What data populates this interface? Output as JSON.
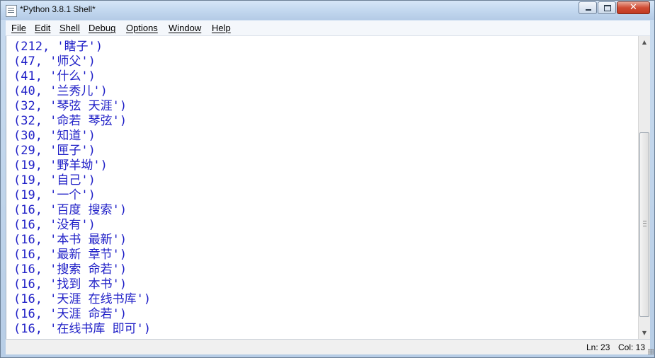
{
  "window": {
    "title": "*Python 3.8.1 Shell*",
    "close_glyph": "✕"
  },
  "menu": [
    "File",
    "Edit",
    "Shell",
    "Debug",
    "Options",
    "Window",
    "Help"
  ],
  "output_lines": [
    "(212, '瞎子')",
    "(47, '师父')",
    "(41, '什么')",
    "(40, '兰秀儿')",
    "(32, '琴弦 天涯')",
    "(32, '命若 琴弦')",
    "(30, '知道')",
    "(29, '匣子')",
    "(19, '野羊坳')",
    "(19, '自己')",
    "(19, '一个')",
    "(16, '百度 搜索')",
    "(16, '没有')",
    "(16, '本书 最新')",
    "(16, '最新 章节')",
    "(16, '搜索 命若')",
    "(16, '找到 本书')",
    "(16, '天涯 在线书库')",
    "(16, '天涯 命若')",
    "(16, '在线书库 即可')"
  ],
  "status": {
    "line": "Ln: 23",
    "col": "Col: 13"
  },
  "colors": {
    "output_text": "#1f1fc7",
    "error_text": "#cc0000"
  }
}
